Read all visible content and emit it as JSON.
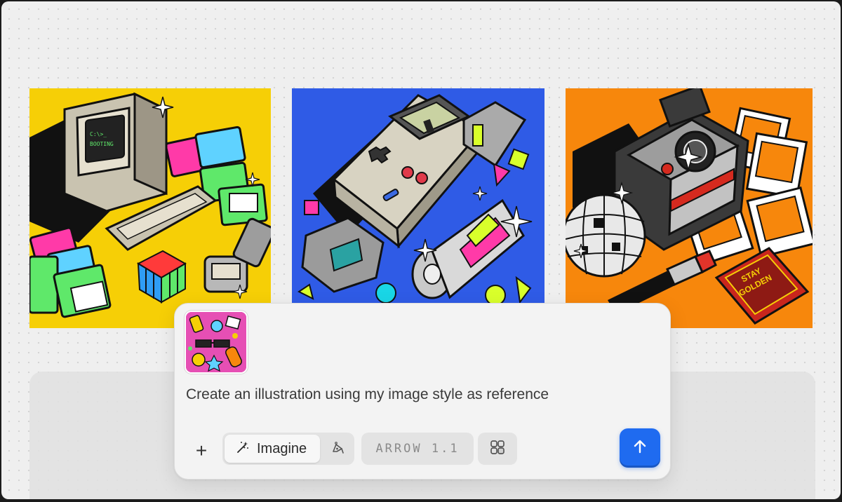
{
  "gallery": {
    "tiles": [
      {
        "icon": "retro-computer-illustration",
        "screen_text_line1": "C:\\>_",
        "screen_text_line2": "BOOTING",
        "background": "#f6cf06"
      },
      {
        "icon": "retro-gameboy-illustration",
        "background": "#2f5be6"
      },
      {
        "icon": "retro-polaroid-illustration",
        "matchbook_text_line1": "STAY",
        "matchbook_text_line2": "GOLDEN",
        "background": "#f7870c"
      }
    ]
  },
  "composer": {
    "reference_image": {
      "icon": "pink-pattern-thumbnail"
    },
    "prompt": "Create an illustration using my image style as reference",
    "add_icon": "plus-icon",
    "add_label": "+",
    "mode": {
      "imagine_label": "Imagine",
      "imagine_icon": "magic-wand-icon",
      "vector_icon": "pen-tool-icon"
    },
    "model_label": "ARROW 1.1",
    "grid_icon": "grid-layout-icon",
    "send_icon": "arrow-up-icon",
    "accent_color": "#1f6bf0"
  }
}
